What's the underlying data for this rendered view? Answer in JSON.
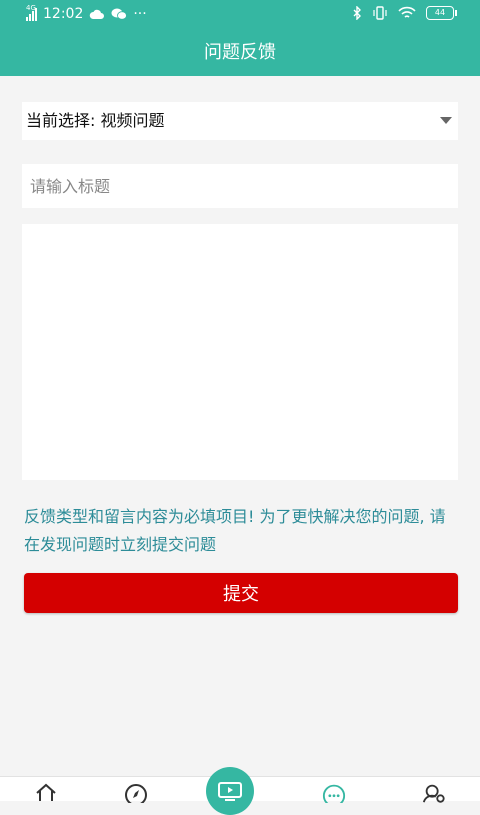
{
  "status_bar": {
    "network": "4G",
    "time": "12:02",
    "more": "···",
    "battery": "44"
  },
  "header": {
    "title": "问题反馈"
  },
  "form": {
    "type_select": {
      "value": "当前选择: 视频问题"
    },
    "title_input": {
      "placeholder": "请输入标题",
      "value": ""
    },
    "content_textarea": {
      "value": ""
    },
    "notice_text": "反馈类型和留言内容为必填项目! 为了更快解决您的问题, 请在发现问题时立刻提交问题",
    "submit_label": "提交"
  },
  "bottom_nav": {
    "items": [
      {
        "icon": "home-icon"
      },
      {
        "icon": "compass-icon"
      },
      {
        "icon": "tv-icon"
      },
      {
        "icon": "chat-icon"
      },
      {
        "icon": "user-settings-icon"
      }
    ]
  },
  "colors": {
    "primary": "#35b7a2",
    "submit": "#d40000",
    "notice_text": "#2d8c98",
    "background": "#f4f4f4"
  }
}
